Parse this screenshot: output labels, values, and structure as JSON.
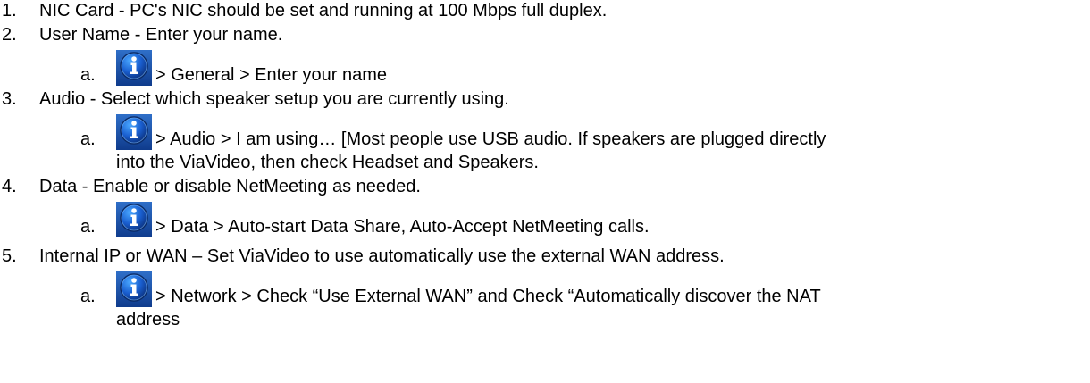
{
  "items": [
    {
      "number": "1.",
      "text": "NIC Card - PC's NIC should be set and running at 100 Mbps full duplex."
    },
    {
      "number": "2.",
      "text": "User Name - Enter your name.",
      "sub": {
        "letter": "a.",
        "icon": "info-icon",
        "text": "> General > Enter your name"
      }
    },
    {
      "number": "3.",
      "text": "Audio - Select which speaker setup you are currently using.",
      "sub": {
        "letter": "a.",
        "icon": "info-icon",
        "text": "> Audio > I am using… [Most people use USB audio. If speakers are plugged directly",
        "continuation": "into the ViaVideo, then check Headset and Speakers."
      }
    },
    {
      "number": "4.",
      "text": "Data - Enable or disable NetMeeting as needed.",
      "sub": {
        "letter": "a.",
        "icon": "info-icon",
        "text": "> Data > Auto-start Data Share, Auto-Accept NetMeeting calls."
      }
    },
    {
      "number": "5.",
      "text": "Internal IP or WAN – Set ViaVideo to use automatically use the external WAN address.",
      "sub": {
        "letter": "a.",
        "icon": "info-icon",
        "text": "> Network > Check “Use External WAN” and Check “Automatically discover the NAT",
        "continuation": "address"
      }
    }
  ],
  "colors": {
    "text": "#000000",
    "icon_background": "#1a4fa8",
    "icon_glyph": "#ffffff"
  }
}
